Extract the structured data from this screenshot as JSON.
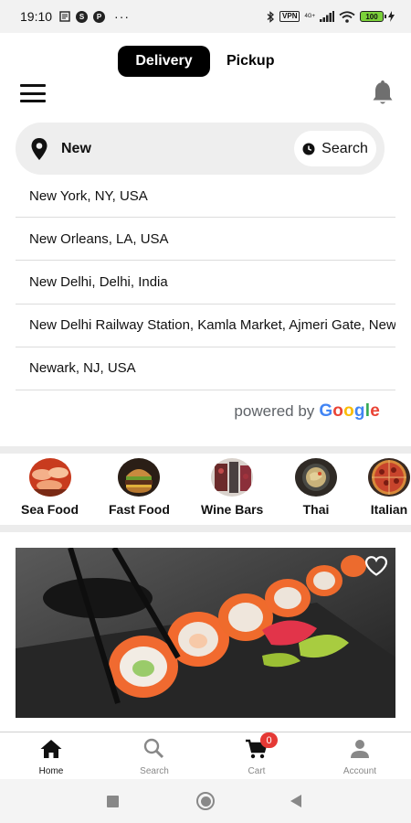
{
  "status_bar": {
    "time": "19:10",
    "vpn_label": "VPN",
    "network_label": "4G+",
    "battery": "100"
  },
  "header": {
    "modes": [
      {
        "label": "Delivery",
        "active": true
      },
      {
        "label": "Pickup",
        "active": false
      }
    ],
    "menu_icon": "hamburger-icon",
    "notification_icon": "bell-icon"
  },
  "search": {
    "value": "New",
    "button_label": "Search",
    "location_icon": "map-pin-icon",
    "clock_icon": "clock-icon"
  },
  "suggestions": [
    "New York, NY, USA",
    "New Orleans, LA, USA",
    "New Delhi, Delhi, India",
    "New Delhi Railway Station, Kamla Market, Ajmeri Gate, New Delhi, Delhi, India",
    "Newark, NJ, USA"
  ],
  "powered_by": {
    "prefix": "powered by",
    "brand": "Google"
  },
  "categories": [
    {
      "label": "Sea Food"
    },
    {
      "label": "Fast Food"
    },
    {
      "label": "Wine Bars"
    },
    {
      "label": "Thai"
    },
    {
      "label": "Italian"
    }
  ],
  "bottom_nav": [
    {
      "label": "Home",
      "icon": "home-icon",
      "active": true
    },
    {
      "label": "Search",
      "icon": "search-icon",
      "active": false
    },
    {
      "label": "Cart",
      "icon": "cart-icon",
      "active": false,
      "badge": "0"
    },
    {
      "label": "Account",
      "icon": "account-icon",
      "active": false
    }
  ],
  "colors": {
    "accent": "#000000",
    "badge": "#e53935",
    "google_blue": "#4285F4",
    "google_red": "#EA4335",
    "google_yellow": "#FBBC05",
    "google_green": "#34A853"
  }
}
